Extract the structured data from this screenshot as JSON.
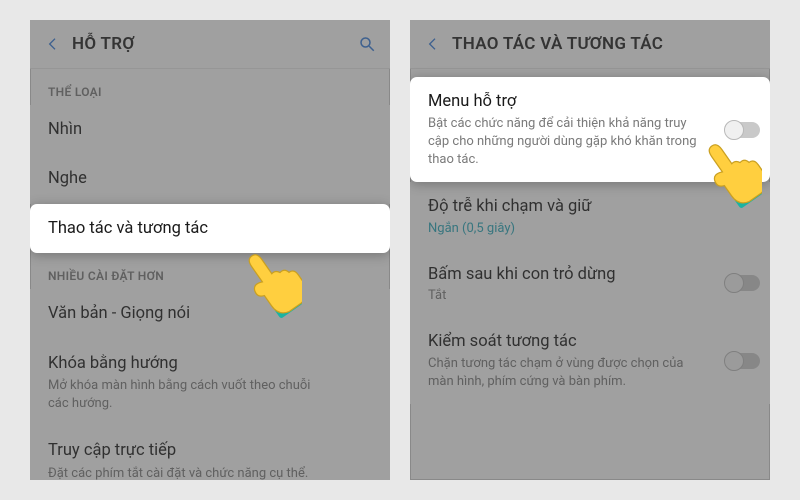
{
  "left": {
    "header": {
      "title": "HỖ TRỢ"
    },
    "sections": {
      "category": "THỂ LOẠI",
      "more": "NHIỀU CÀI ĐẶT HƠN"
    },
    "rows": {
      "nhin": {
        "label": "Nhìn"
      },
      "nghe": {
        "label": "Nghe"
      },
      "thaotac": {
        "label": "Thao tác và tương tác"
      },
      "vanban": {
        "label": "Văn bản - Giọng nói"
      },
      "khoa": {
        "label": "Khóa bằng hướng",
        "desc": "Mở khóa màn hình bằng cách vuốt theo chuỗi các hướng."
      },
      "truycap": {
        "label": "Truy cập trực tiếp",
        "desc": "Đặt các phím tắt cài đặt và chức năng cụ thể."
      }
    }
  },
  "right": {
    "header": {
      "title": "THAO TÁC VÀ TƯƠNG TÁC"
    },
    "rows": {
      "menu": {
        "label": "Menu hỗ trợ",
        "desc": "Bật các chức năng để cải thiện khả năng truy cập cho những người dùng gặp khó khăn trong thao tác."
      },
      "dotre": {
        "label": "Độ trễ khi chạm và giữ",
        "value": "Ngắn (0,5 giây)"
      },
      "bamsau": {
        "label": "Bấm sau khi con trỏ dừng",
        "value": "Tắt"
      },
      "kiemsoat": {
        "label": "Kiểm soát tương tác",
        "desc": "Chặn tương tác chạm ở vùng được chọn của màn hình, phím cứng và bàn phím."
      }
    }
  }
}
